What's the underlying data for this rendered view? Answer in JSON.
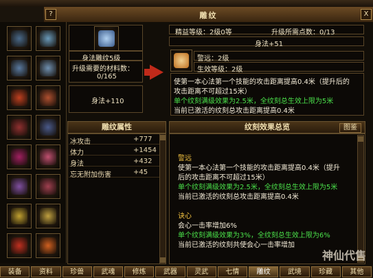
{
  "window": {
    "title": "雕纹",
    "help_label": "?",
    "close_label": "X"
  },
  "left_items": [
    {
      "name": "slot-1",
      "color": "#4a6a8a"
    },
    {
      "name": "slot-2",
      "color": "#6a9aba"
    },
    {
      "name": "slot-3",
      "color": "#5a7aa0"
    },
    {
      "name": "slot-4",
      "color": "#7090b0"
    },
    {
      "name": "slot-5",
      "color": "#c04020"
    },
    {
      "name": "slot-6",
      "color": "#b05030"
    },
    {
      "name": "slot-7",
      "color": "#903030"
    },
    {
      "name": "slot-8",
      "color": "#4a5a8a"
    },
    {
      "name": "slot-9",
      "color": "#a02060"
    },
    {
      "name": "slot-10",
      "color": "#c05070"
    },
    {
      "name": "slot-11",
      "color": "#8050a0"
    },
    {
      "name": "slot-12",
      "color": "#a04050"
    },
    {
      "name": "slot-13",
      "color": "#c0a030"
    },
    {
      "name": "slot-14",
      "color": "#c0a040"
    },
    {
      "name": "slot-15",
      "color": "#c03020"
    },
    {
      "name": "slot-16",
      "color": "#d06020"
    }
  ],
  "selected": {
    "item_name": "身法雕纹5级",
    "materials_label": "升级需要的材料数：",
    "materials_value": "0/165",
    "stat_label": "身法+110"
  },
  "upgrade": {
    "refine_level": "精益等级：2级0等",
    "upgrade_points": "升级所需点数：0/13",
    "stat_next": "身法+51",
    "skill_name": "警远：2级",
    "effect_level": "生效等级：2级",
    "desc_line1": "使第一本心法第一个技能的攻击距离提高0.4米（提升后的",
    "desc_line2": "攻击距离不可超过15米）",
    "desc_line3": "单个纹刻满级效果为2.5米，全纹刻总生效上限为5米",
    "desc_line4": "当前已激活的纹刻总攻击距离提高0.4米"
  },
  "attr_panel": {
    "header": "雕纹属性",
    "rows": [
      {
        "k": "冰攻击",
        "v": "+777"
      },
      {
        "k": "体力",
        "v": "+1454"
      },
      {
        "k": "身法",
        "v": "+432"
      },
      {
        "k": "忘无附加伤害",
        "v": "+45"
      }
    ]
  },
  "overview": {
    "header": "纹刻效果总览",
    "icon_button": "图鉴",
    "s1_title": "警远",
    "s1_l1": "使第一本心法第一个技能的攻击距离提高0.4米（提升",
    "s1_l2": "后的攻击距离不可超过15米）",
    "s1_l3": "单个纹刻满级效果为2.5米，全纹刻总生效上限为5米",
    "s1_l4": "当前已激活的纹刻总攻击距离提高0.4米",
    "s2_title": "诀心",
    "s2_l1": "会心一击率增加6%",
    "s2_l2": "单个纹刻满级效果为3%，全纹刻总生效上限为6%",
    "s2_l3": "当前已激活的纹刻共使会心一击率增加"
  },
  "tabs": [
    "装备",
    "资料",
    "珍兽",
    "武魂",
    "修炼",
    "武器",
    "灵武",
    "七情",
    "雕纹",
    "武境",
    "珍藏",
    "其他"
  ],
  "active_tab": "雕纹",
  "watermark": "神仙代售"
}
